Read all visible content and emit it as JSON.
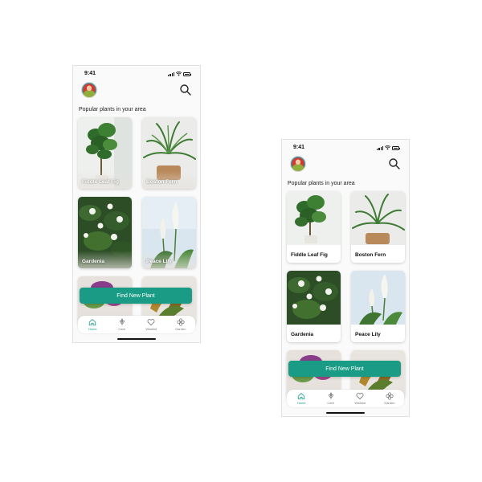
{
  "status": {
    "time": "9:41"
  },
  "section_title": "Popular plants in your area",
  "plants": [
    {
      "name": "Fiddle Leaf Fig"
    },
    {
      "name": "Boston Fern"
    },
    {
      "name": "Gardenia"
    },
    {
      "name": "Peace Lily"
    },
    {
      "name": ""
    },
    {
      "name": ""
    }
  ],
  "cta_label": "Find New Plant",
  "tabs": [
    {
      "label": "Home",
      "icon": "home-icon"
    },
    {
      "label": "Care",
      "icon": "leaf-icon"
    },
    {
      "label": "Wishlist",
      "icon": "heart-icon"
    },
    {
      "label": "Garden",
      "icon": "flower-icon"
    }
  ],
  "colors": {
    "accent": "#1a9b85"
  }
}
